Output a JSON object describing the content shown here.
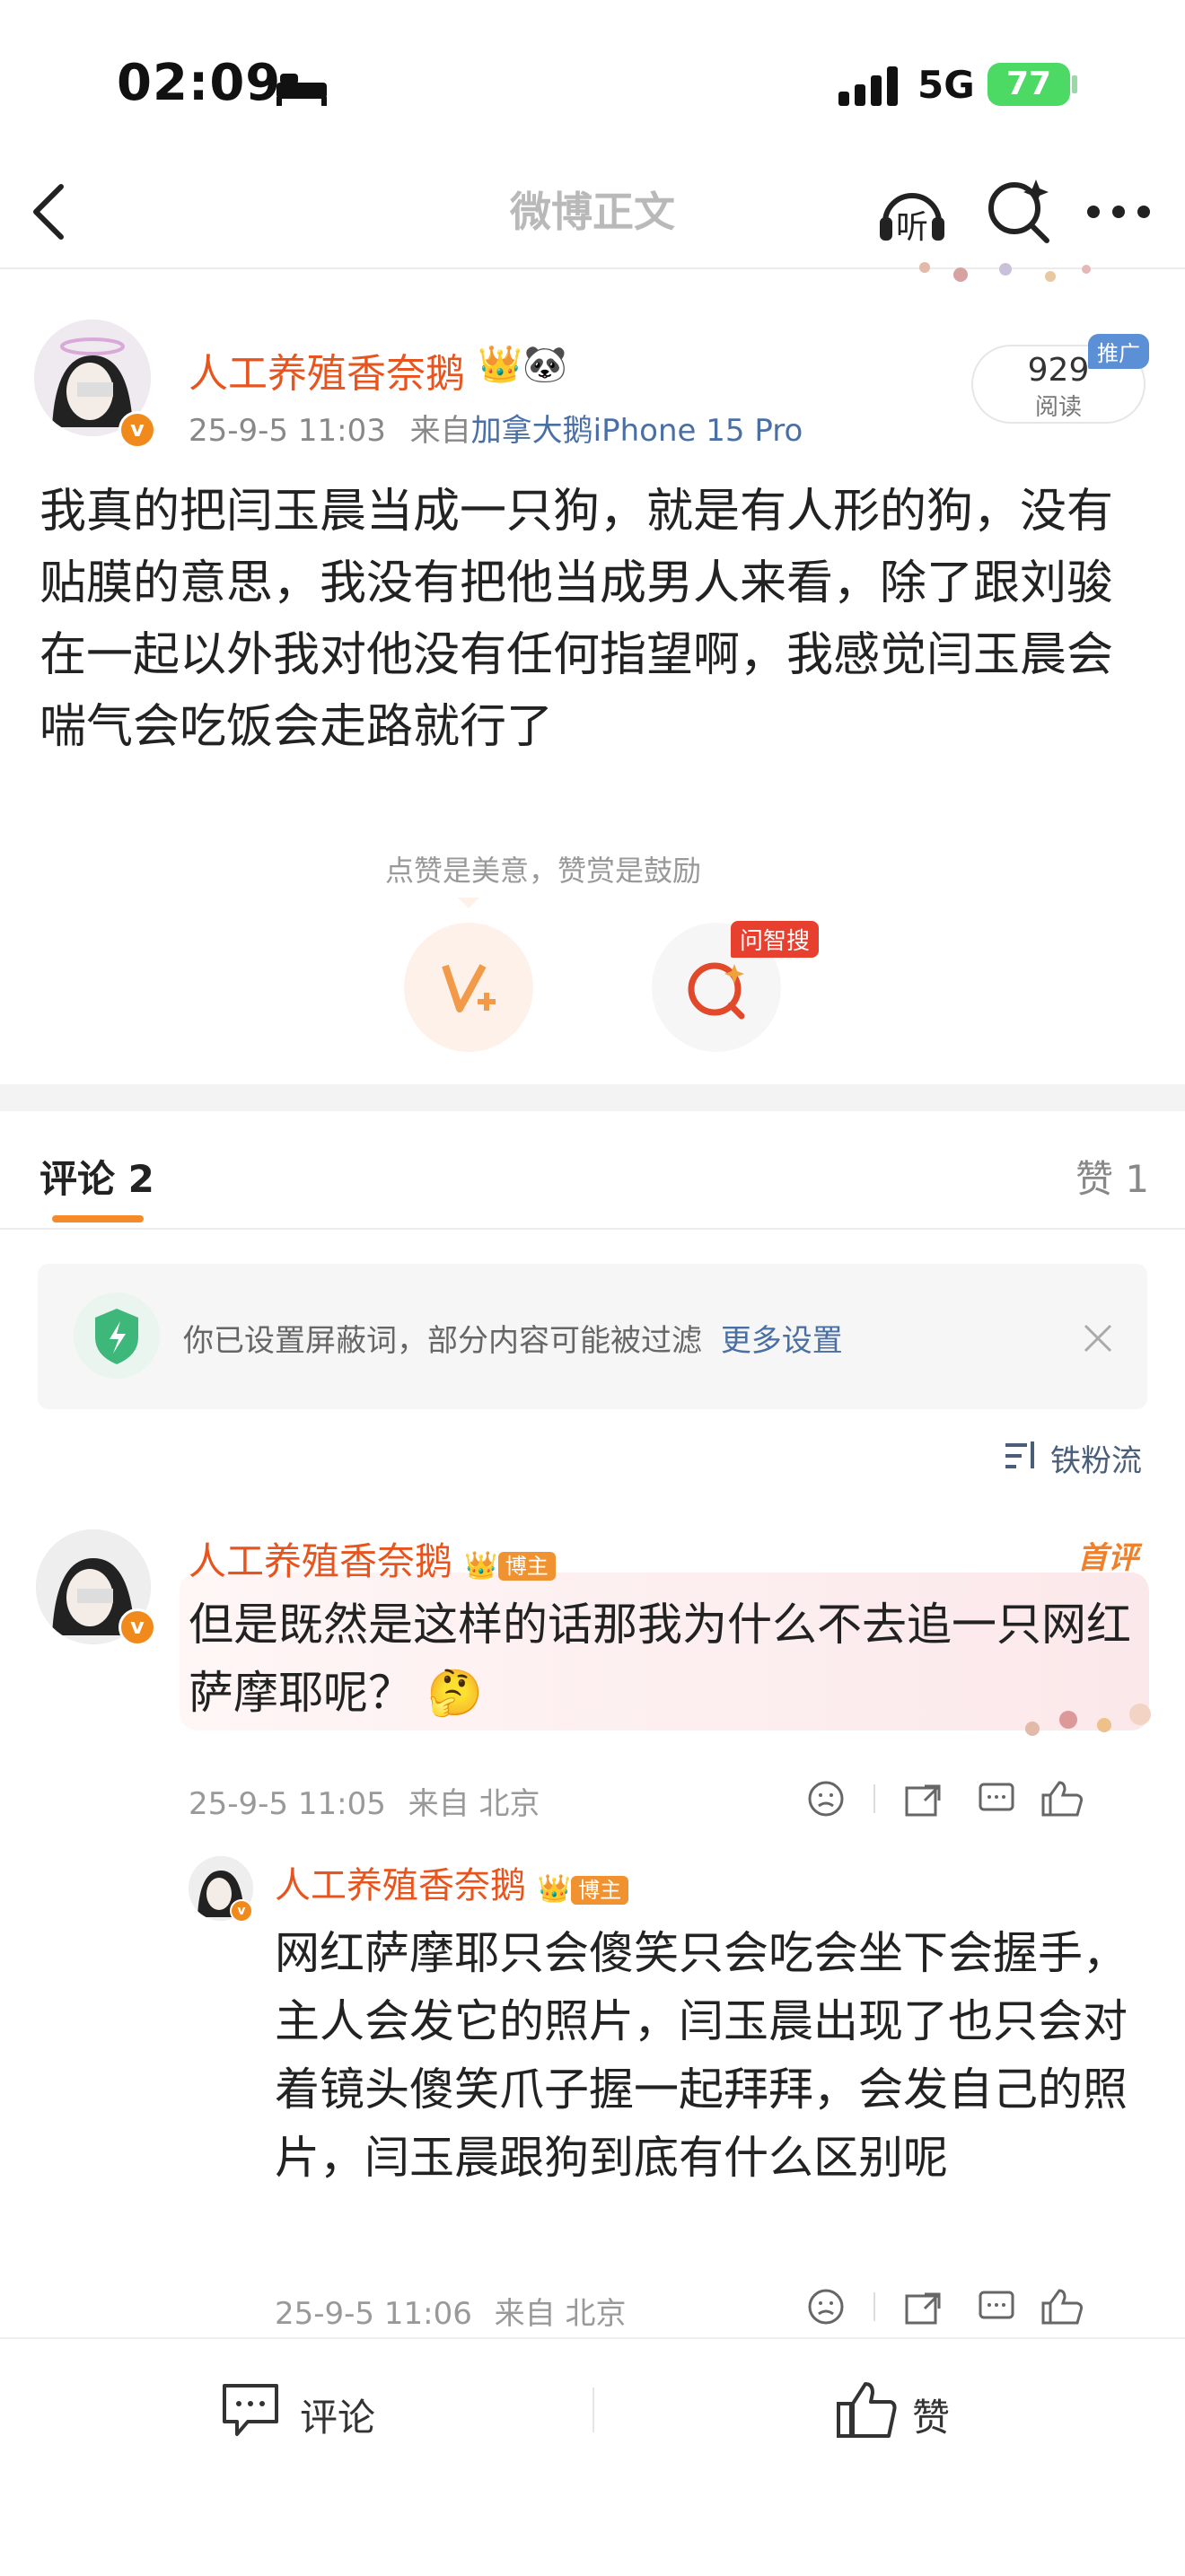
{
  "status_bar": {
    "time": "02:09",
    "network": "5G",
    "battery": "77"
  },
  "nav": {
    "title": "微博正文",
    "listen_label": "听"
  },
  "post": {
    "username": "人工养殖香奈鹅",
    "date": "25-9-5 11:03",
    "source_prefix": "来自",
    "source_device": "加拿大鹅iPhone 15 Pro",
    "reads_count": "929",
    "reads_label": "阅读",
    "ad_tag": "推广",
    "text": "我真的把闫玉晨当成一只狗，就是有人形的狗，没有贴膜的意思，我没有把他当成男人来看，除了跟刘骏在一起以外我对他没有任何指望啊，我感觉闫玉晨会喘气会吃饭会走路就行了",
    "reward_hint": "点赞是美意，赞赏是鼓励",
    "ask_tag": "问智搜"
  },
  "tabs": {
    "comments": "评论 2",
    "likes": "赞 1"
  },
  "notice": {
    "text": "你已设置屏蔽词，部分内容可能被过滤",
    "link": "更多设置"
  },
  "sort_label": "铁粉流",
  "comments": [
    {
      "username": "人工养殖香奈鹅",
      "badge": "博主",
      "first_tag": "首评",
      "text": "但是既然是这样的话那我为什么不去追一只网红萨摩耶呢？ 🤔",
      "date": "25-9-5 11:05",
      "location": "来自 北京"
    },
    {
      "username": "人工养殖香奈鹅",
      "badge": "博主",
      "text": "网红萨摩耶只会傻笑只会吃会坐下会握手，主人会发它的照片，闫玉晨出现了也只会对着镜头傻笑爪子握一起拜拜，会发自己的照片，闫玉晨跟狗到底有什么区别呢",
      "date": "25-9-5 11:06",
      "location": "来自 北京"
    }
  ],
  "bottom_bar": {
    "comment_label": "评论",
    "like_label": "赞"
  },
  "colors": {
    "accent": "#e8541e",
    "link": "#4a6fa5",
    "tab_underline": "#f58a2a"
  }
}
